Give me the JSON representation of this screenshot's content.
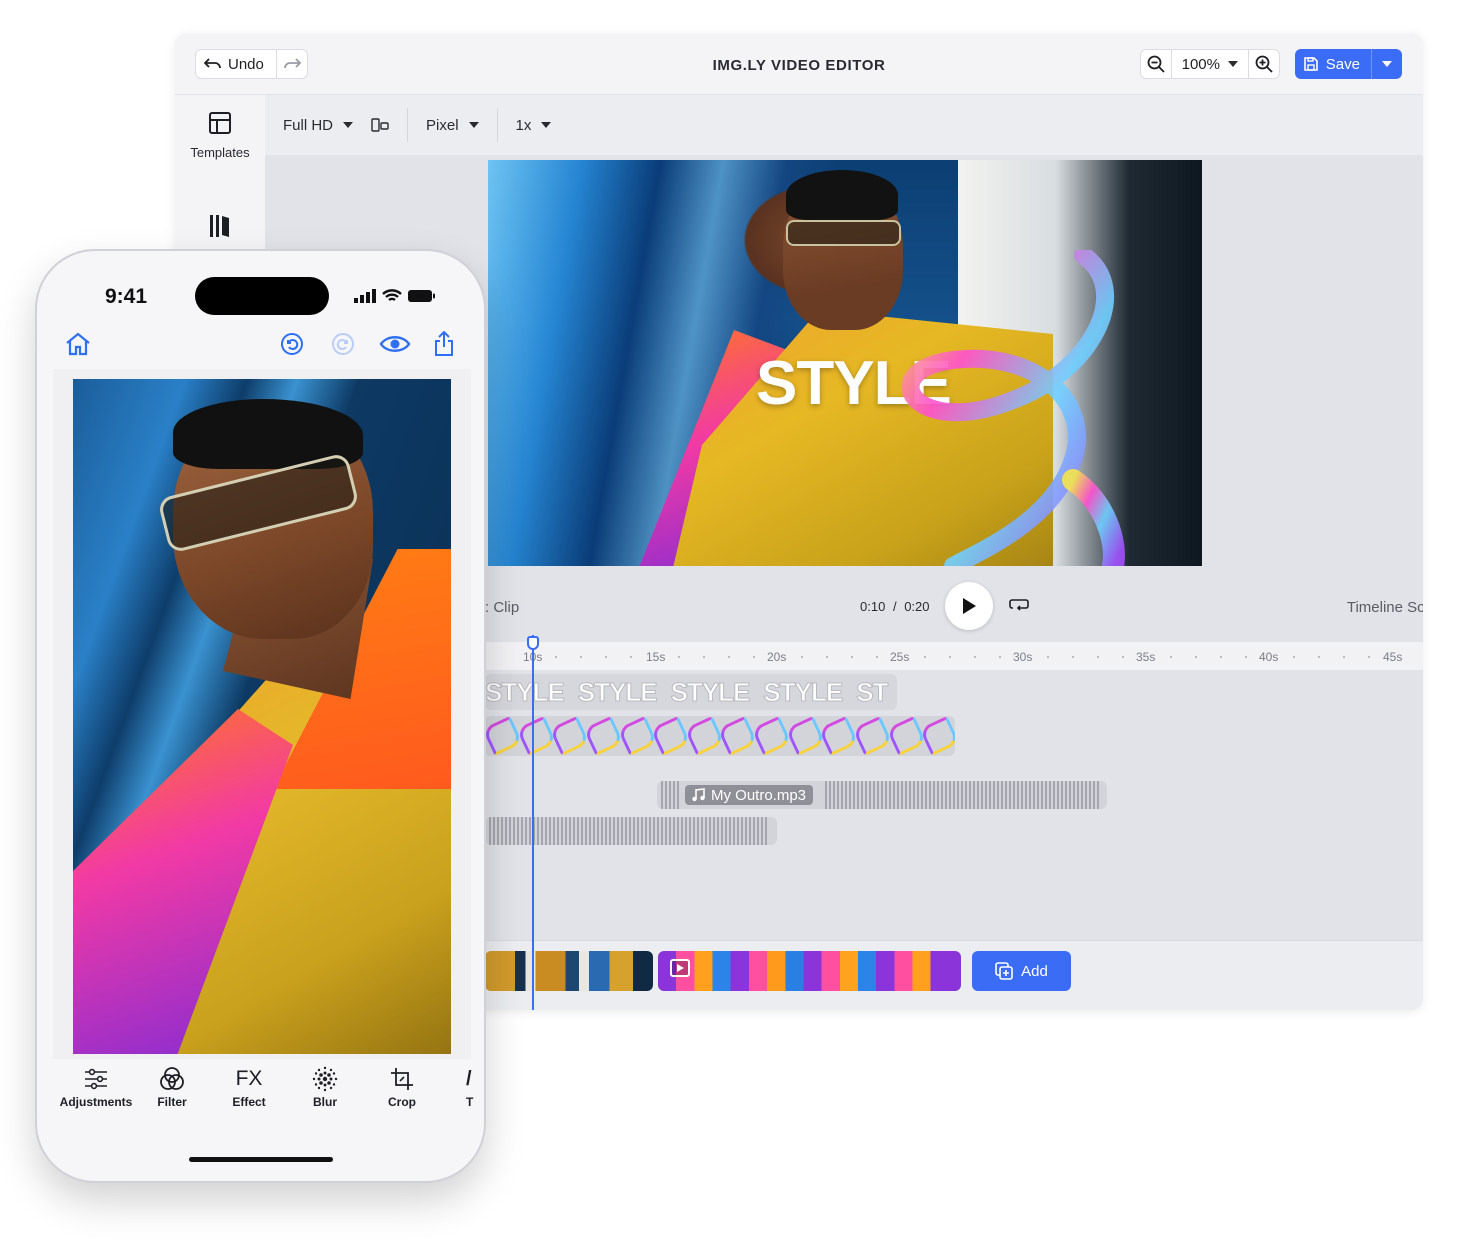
{
  "desktop": {
    "toolbar": {
      "undo_label": "Undo",
      "title": "IMG.LY VIDEO EDITOR",
      "zoom_value": "100%",
      "save_label": "Save"
    },
    "sidebar": {
      "items": [
        {
          "label": "Templates",
          "icon": "templates-icon"
        },
        {
          "label": "",
          "icon": "library-icon"
        }
      ]
    },
    "format_bar": {
      "resolution": "Full HD",
      "unit": "Pixel",
      "scale": "1x"
    },
    "canvas": {
      "overlay_text": "STYLE"
    },
    "transport": {
      "clip_label": ": Clip",
      "current_time": "0:10",
      "separator": "/",
      "duration": "0:20",
      "scale_label": "Timeline Sca"
    },
    "ruler": {
      "ticks": [
        "10s",
        "15s",
        "20s",
        "25s",
        "30s",
        "35s",
        "40s",
        "45s"
      ]
    },
    "tracks": {
      "text_clip": [
        "STYLE",
        "STYLE",
        "STYLE",
        "STYLE",
        "ST"
      ],
      "audio_label": "My Outro.mp3"
    },
    "clips": {
      "add_label": "Add"
    },
    "colors": {
      "accent": "#3b6cf6",
      "panel_bg": "#ecedf1"
    }
  },
  "phone": {
    "status_time": "9:41",
    "tabs": [
      {
        "label": "Adjustments",
        "icon": "adjustments-icon"
      },
      {
        "label": "Filter",
        "icon": "filter-icon"
      },
      {
        "label": "Effect",
        "icon": "fx-icon",
        "glyph": "FX"
      },
      {
        "label": "Blur",
        "icon": "blur-icon"
      },
      {
        "label": "Crop",
        "icon": "crop-icon"
      },
      {
        "label": "T",
        "icon": "text-icon"
      }
    ]
  }
}
